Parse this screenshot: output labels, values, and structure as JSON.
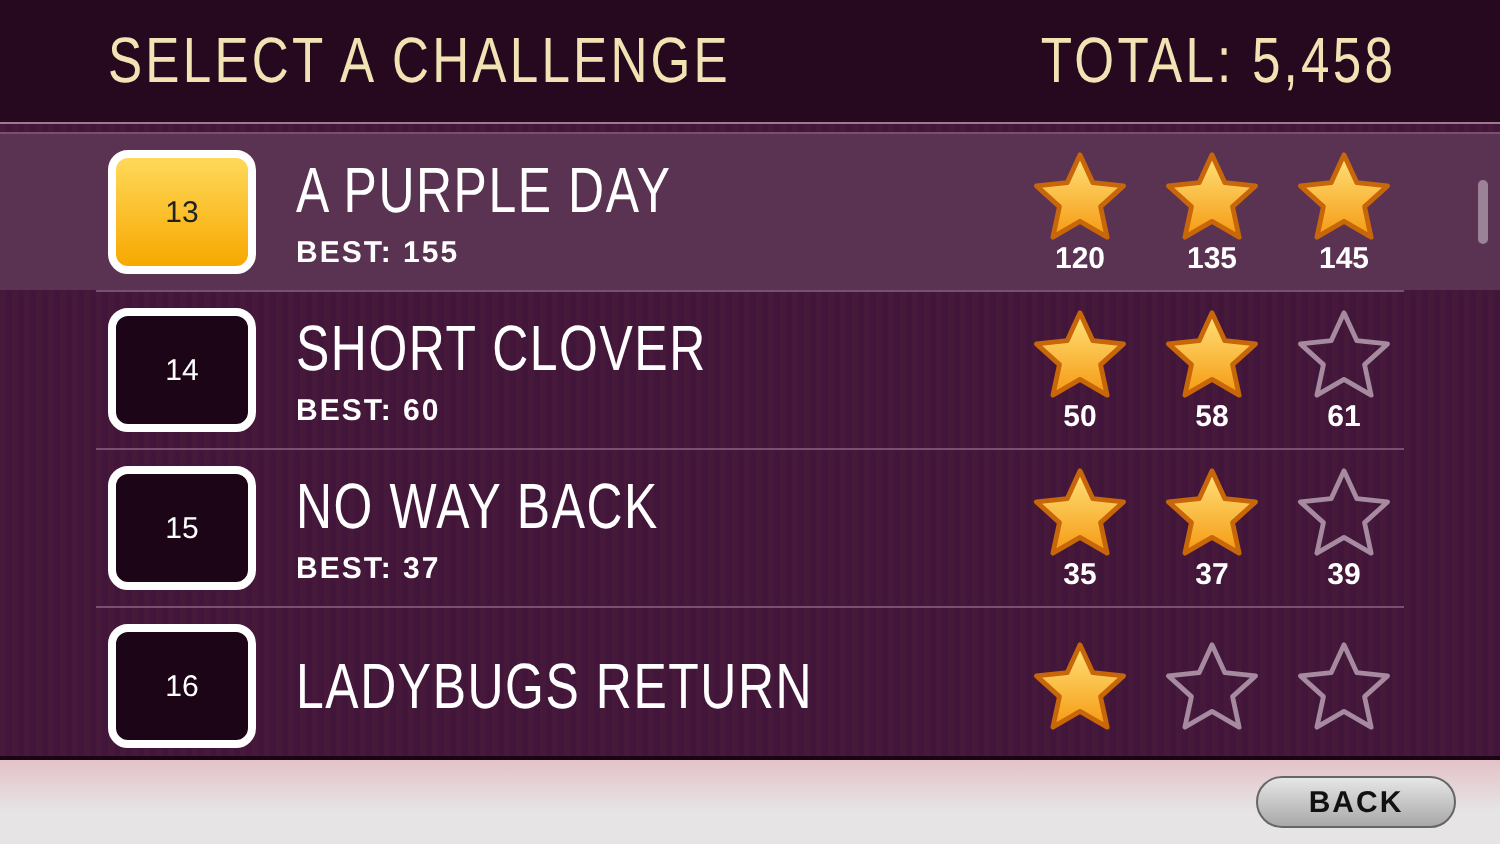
{
  "header": {
    "title": "SELECT A CHALLENGE",
    "total": "TOTAL: 5,458"
  },
  "rows": [
    {
      "number": "13",
      "name": "A PURPLE DAY",
      "best": "BEST: 155",
      "selected": true,
      "stars": 3,
      "thresholds": [
        "120",
        "135",
        "145"
      ]
    },
    {
      "number": "14",
      "name": "SHORT CLOVER",
      "best": "BEST: 60",
      "selected": false,
      "stars": 2,
      "thresholds": [
        "50",
        "58",
        "61"
      ]
    },
    {
      "number": "15",
      "name": "NO WAY BACK",
      "best": "BEST: 37",
      "selected": false,
      "stars": 2,
      "thresholds": [
        "35",
        "37",
        "39"
      ]
    },
    {
      "number": "16",
      "name": "LADYBUGS RETURN",
      "selected": false,
      "stars": 1
    }
  ],
  "footer": {
    "back": "BACK"
  }
}
